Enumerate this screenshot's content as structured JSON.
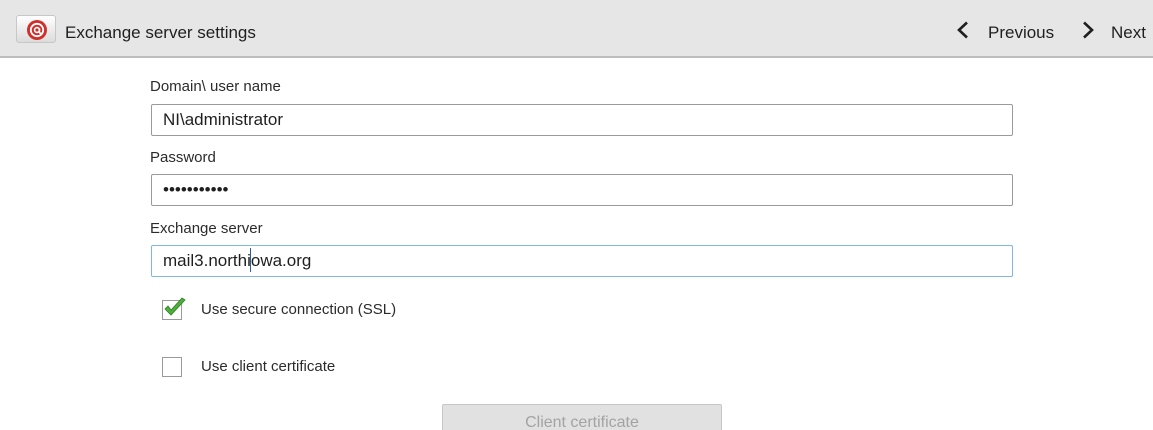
{
  "header": {
    "title": "Exchange server settings",
    "previous_label": "Previous",
    "next_label": "Next",
    "app_icon": "email-at-icon"
  },
  "form": {
    "domain_user": {
      "label": "Domain\\ user name",
      "value": "NI\\administrator"
    },
    "password": {
      "label": "Password",
      "value": "•••••••••••"
    },
    "exchange_server": {
      "label": "Exchange server",
      "value": "mail3.northiowa.org"
    },
    "use_ssl": {
      "label": "Use secure connection (SSL)",
      "checked": true
    },
    "use_client_certificate": {
      "label": "Use client certificate",
      "checked": false
    },
    "client_certificate_button": {
      "label": "Client certificate",
      "enabled": false
    }
  },
  "colors": {
    "action_bar": "#e6e6e6",
    "focus_border": "#7fb7e6",
    "check_green": "#4caf3a",
    "icon_red": "#d0302b"
  }
}
